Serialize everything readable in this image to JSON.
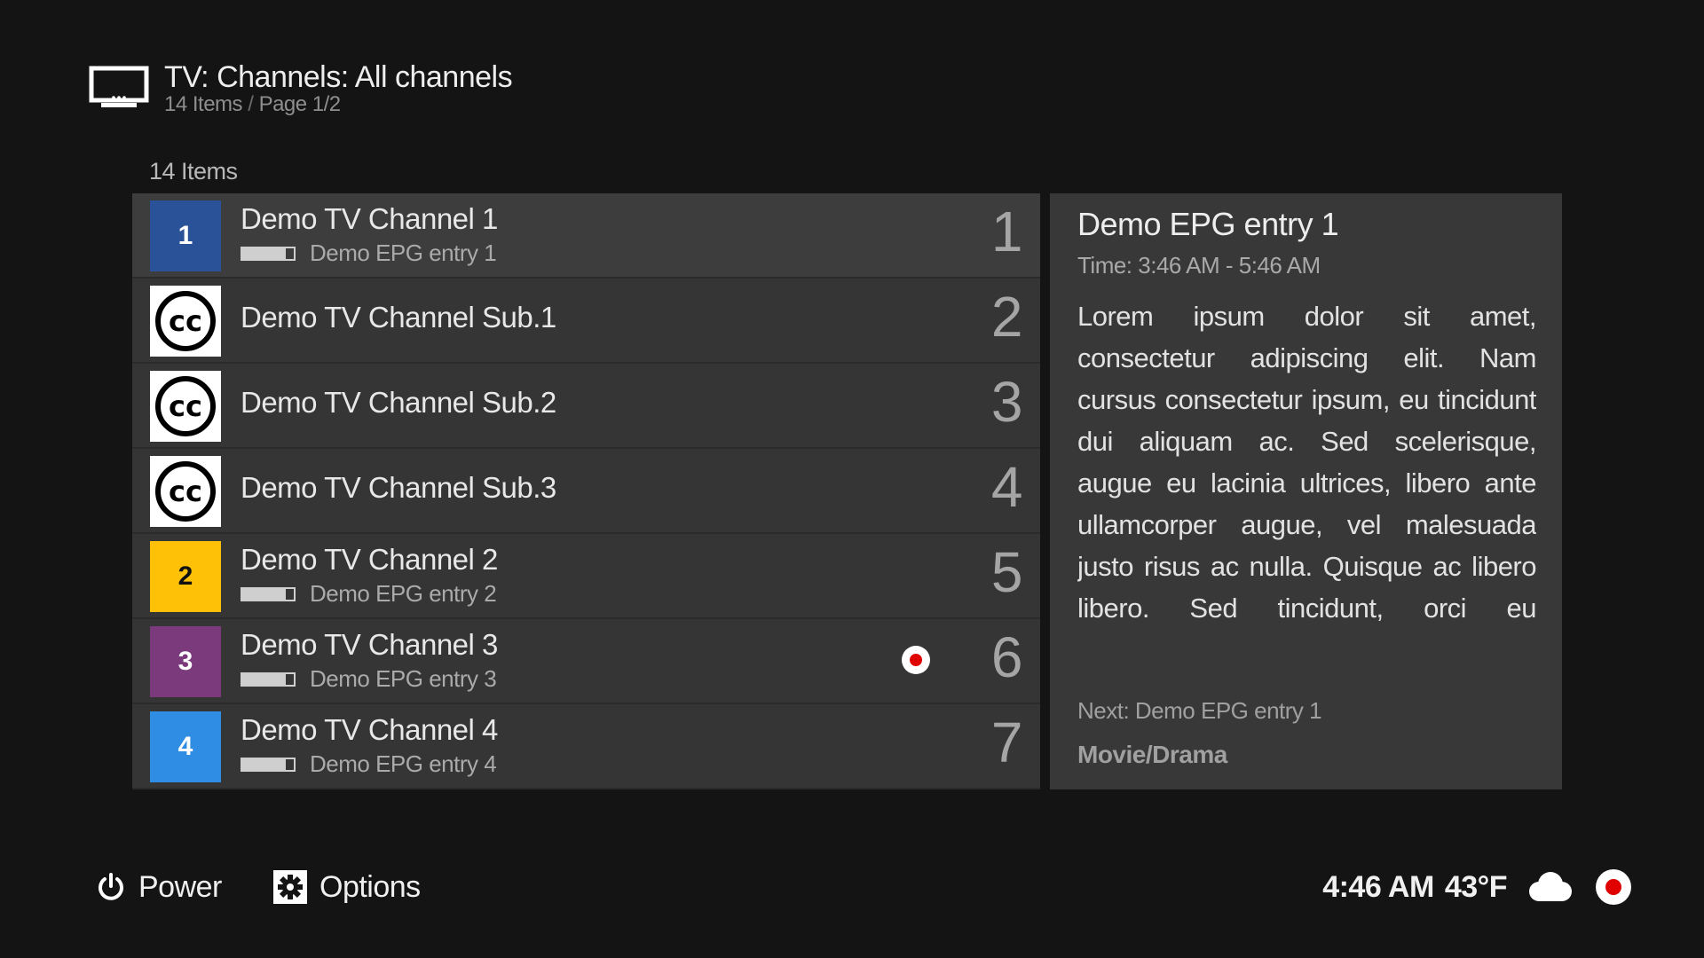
{
  "header": {
    "title": "TV: Channels: All channels",
    "items_count": "14 Items",
    "separator": "/",
    "page": "Page 1/2"
  },
  "list_label": "14 Items",
  "channels": [
    {
      "name": "Demo TV Channel 1",
      "epg": "Demo EPG entry 1",
      "number": "1",
      "logo_text": "1",
      "logo_type": "number",
      "logo_bg": "#2a5298",
      "logo_fg": "#ffffff",
      "progress": 0.85,
      "recording": false,
      "selected": true
    },
    {
      "name": "Demo TV Channel Sub.1",
      "epg": "",
      "number": "2",
      "logo_text": "cc",
      "logo_type": "cc-icon",
      "recording": false
    },
    {
      "name": "Demo TV Channel Sub.2",
      "epg": "",
      "number": "3",
      "logo_text": "cc",
      "logo_type": "cc-icon",
      "recording": false
    },
    {
      "name": "Demo TV Channel Sub.3",
      "epg": "",
      "number": "4",
      "logo_text": "cc",
      "logo_type": "cc-icon",
      "recording": false
    },
    {
      "name": "Demo TV Channel 2",
      "epg": "Demo EPG entry 2",
      "number": "5",
      "logo_text": "2",
      "logo_type": "number",
      "logo_bg": "#ffc107",
      "logo_fg": "#111111",
      "progress": 0.85,
      "recording": false
    },
    {
      "name": "Demo TV Channel 3",
      "epg": "Demo EPG entry 3",
      "number": "6",
      "logo_text": "3",
      "logo_type": "number",
      "logo_bg": "#7b3a7c",
      "logo_fg": "#ffffff",
      "progress": 0.85,
      "recording": true
    },
    {
      "name": "Demo TV Channel 4",
      "epg": "Demo EPG entry 4",
      "number": "7",
      "logo_text": "4",
      "logo_type": "number",
      "logo_bg": "#2f8de4",
      "logo_fg": "#ffffff",
      "progress": 0.85,
      "recording": false
    }
  ],
  "info": {
    "title": "Demo EPG entry 1",
    "time": "Time: 3:46 AM - 5:46 AM",
    "plot": "Lorem ipsum dolor sit amet, consectetur adipiscing elit. Nam cursus consectetur ipsum, eu tincidunt dui aliquam ac. Sed scelerisque, augue eu lacinia ultrices, libero ante ullamcorper augue, vel malesuada justo risus ac nulla. Quisque ac libero libero. Sed tincidunt, orci eu condimentum laoreet, felis odio mattis est, et lacinia metus enim in leo. Fusce",
    "next": "Next: Demo EPG entry 1",
    "genre": "Movie/Drama"
  },
  "footer": {
    "power_label": "Power",
    "power_icon": "power-icon",
    "options_label": "Options",
    "options_icon": "gear-icon",
    "clock": "4:46 AM",
    "temperature": "43°F",
    "weather_icon": "cloud-icon",
    "recording_icon": "record-icon"
  },
  "colors": {
    "background": "#141414",
    "row": "#353535",
    "row_selected": "#3d3d3d",
    "info_panel": "#383838",
    "record_red": "#e00000"
  }
}
